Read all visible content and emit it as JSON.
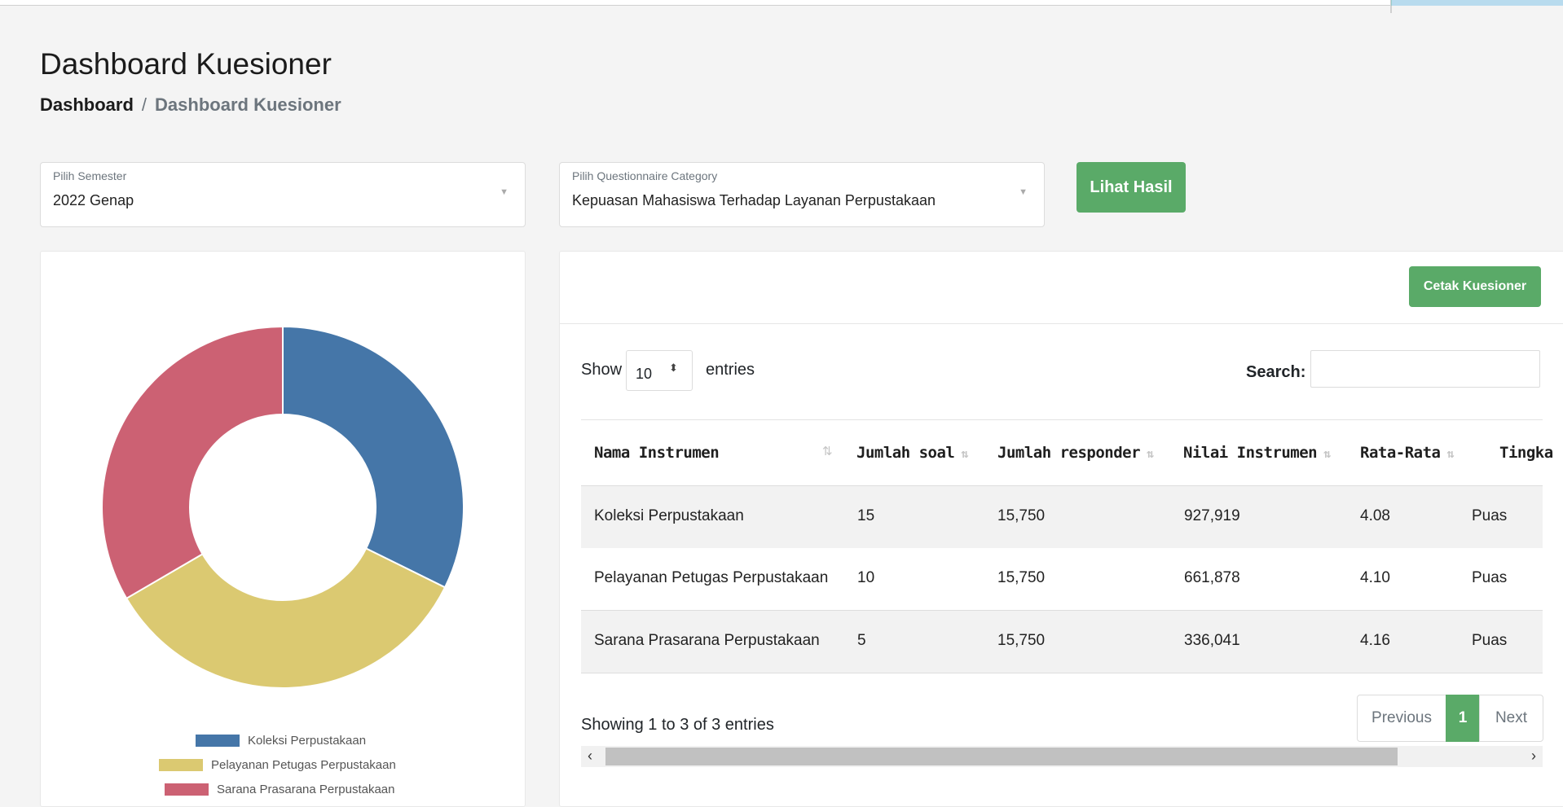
{
  "page": {
    "title": "Dashboard Kuesioner"
  },
  "breadcrumb": {
    "home": "Dashboard",
    "separator": "/",
    "current": "Dashboard Kuesioner"
  },
  "filters": {
    "semester": {
      "label": "Pilih Semester",
      "value": "2022 Genap"
    },
    "category": {
      "label": "Pilih Questionnaire Category",
      "value": "Kepuasan Mahasiswa Terhadap Layanan Perpustakaan"
    },
    "submit_label": "Lihat Hasil"
  },
  "chart_data": {
    "type": "pie",
    "donut": true,
    "categories": [
      "Koleksi Perpustakaan",
      "Pelayanan Petugas Perpustakaan",
      "Sarana Prasarana Perpustakaan"
    ],
    "values": [
      0.323,
      0.343,
      0.334
    ],
    "colors": [
      "#4576a8",
      "#dbc971",
      "#cc6173"
    ],
    "legend_position": "bottom"
  },
  "table_card": {
    "print_label": "Cetak Kuesioner",
    "show_label": "Show",
    "entries_label": "entries",
    "page_length": "10",
    "search_label": "Search:",
    "columns": [
      "Nama Instrumen",
      "Jumlah soal",
      "Jumlah responder",
      "Nilai Instrumen",
      "Rata-Rata",
      "Tingka"
    ],
    "rows": [
      [
        "Koleksi Perpustakaan",
        "15",
        "15,750",
        "927,919",
        "4.08",
        "Puas"
      ],
      [
        "Pelayanan Petugas Perpustakaan",
        "10",
        "15,750",
        "661,878",
        "4.10",
        "Puas"
      ],
      [
        "Sarana Prasarana Perpustakaan",
        "5",
        "15,750",
        "336,041",
        "4.16",
        "Puas"
      ]
    ],
    "info": "Showing 1 to 3 of 3 entries",
    "pagination": {
      "previous": "Previous",
      "current": "1",
      "next": "Next"
    }
  },
  "icons": {
    "sort": "sort-icon",
    "caret": "caret-down-icon",
    "scroll_left": "chevron-left-icon",
    "scroll_right": "chevron-right-icon"
  }
}
